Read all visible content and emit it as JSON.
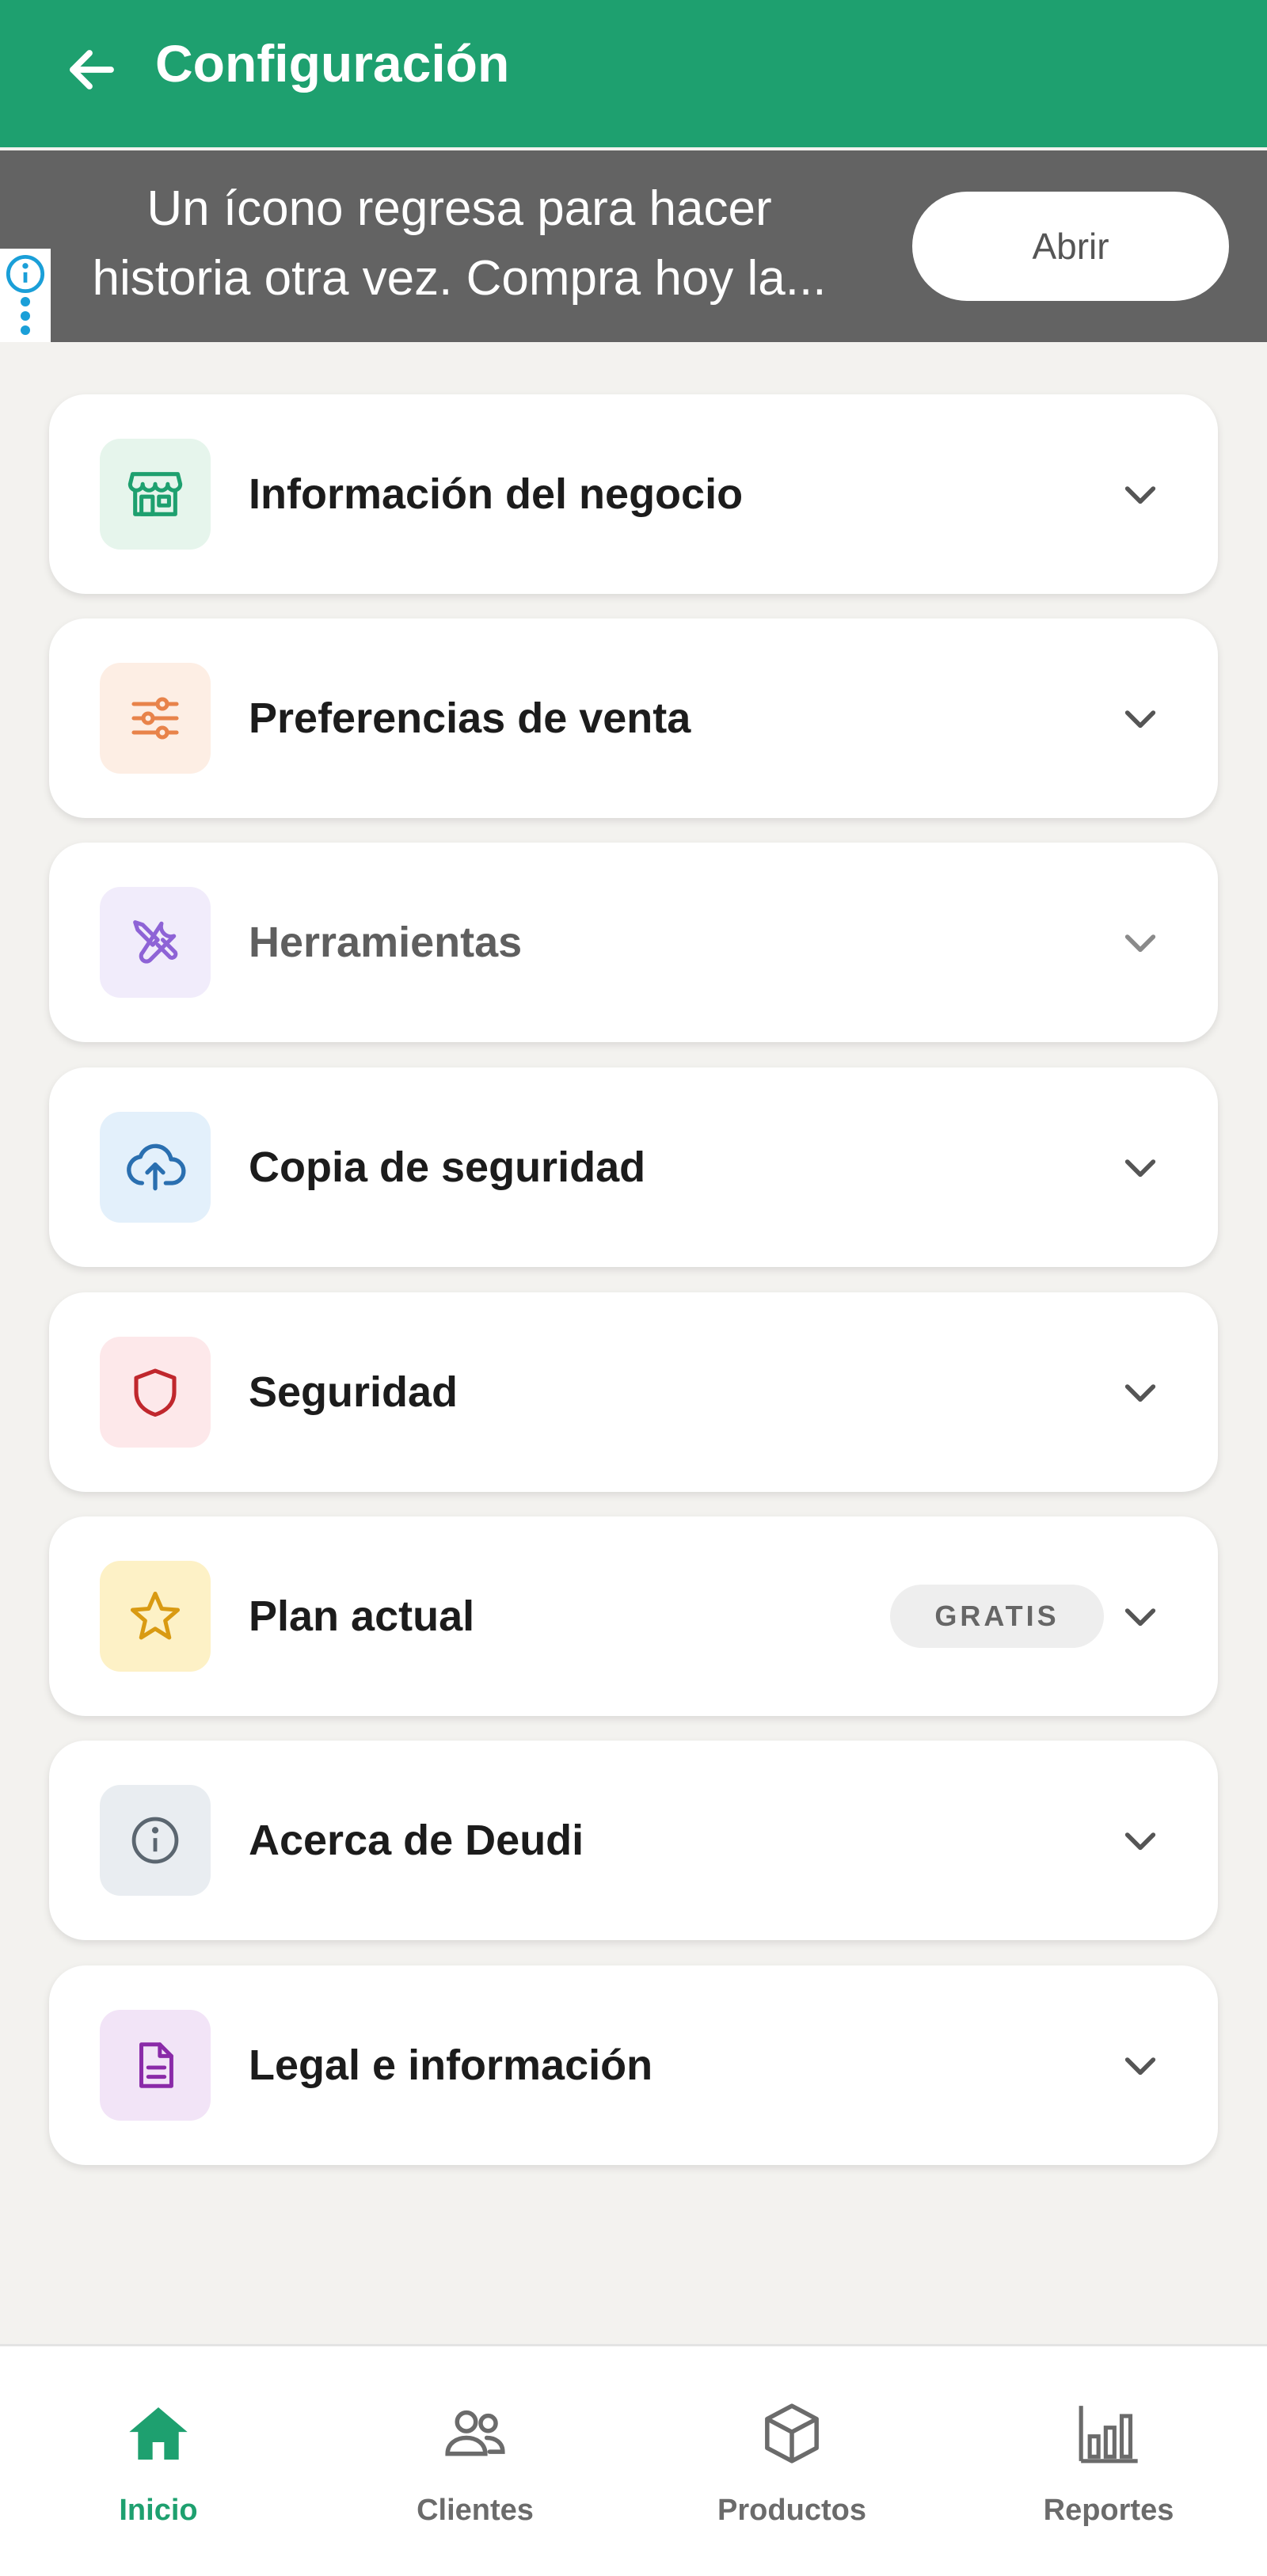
{
  "header": {
    "title": "Configuración",
    "background_color": "#1ea06f"
  },
  "ad": {
    "text_line1": "Un ícono regresa para hacer",
    "text_line2": "historia otra vez. Compra hoy la...",
    "button_label": "Abrir"
  },
  "settings": {
    "items": [
      {
        "label": "Información del negocio",
        "icon": "store-icon",
        "icon_bg": "#e6f5ec",
        "icon_color": "#1ea06f"
      },
      {
        "label": "Preferencias de venta",
        "icon": "sliders-icon",
        "icon_bg": "#fdeee4",
        "icon_color": "#e8834a"
      },
      {
        "label": "Herramientas",
        "icon": "tools-icon",
        "icon_bg": "#f1ecfb",
        "icon_color": "#8e63d6"
      },
      {
        "label": "Copia de seguridad",
        "icon": "cloud-upload-icon",
        "icon_bg": "#e3f0fb",
        "icon_color": "#2a6fb0"
      },
      {
        "label": "Seguridad",
        "icon": "shield-icon",
        "icon_bg": "#fde8ea",
        "icon_color": "#c0272d"
      },
      {
        "label": "Plan actual",
        "icon": "star-icon",
        "icon_bg": "#fdf1c6",
        "icon_color": "#d99a12",
        "badge": "GRATIS"
      },
      {
        "label": "Acerca de Deudi",
        "icon": "info-icon",
        "icon_bg": "#e9edf1",
        "icon_color": "#5b6670"
      },
      {
        "label": "Legal e información",
        "icon": "document-icon",
        "icon_bg": "#f2e4f7",
        "icon_color": "#8a2aa8"
      }
    ]
  },
  "nav": {
    "items": [
      {
        "label": "Inicio",
        "icon": "home-icon",
        "active": true
      },
      {
        "label": "Clientes",
        "icon": "users-icon"
      },
      {
        "label": "Productos",
        "icon": "box-icon"
      },
      {
        "label": "Reportes",
        "icon": "bar-chart-icon"
      }
    ],
    "active_color": "#1ea06f"
  }
}
